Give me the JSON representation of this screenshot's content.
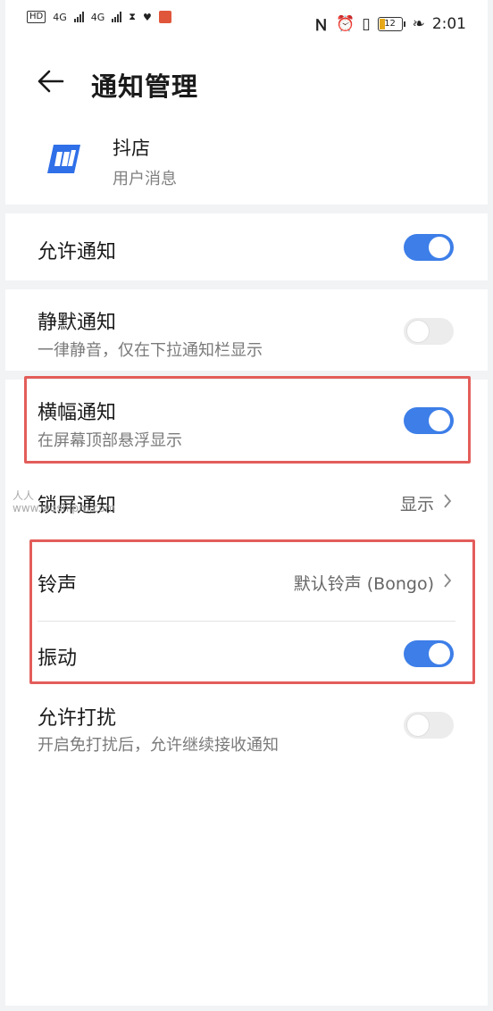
{
  "status_bar": {
    "left_labels": [
      "HD",
      "4G",
      "4G"
    ],
    "battery_level": "12",
    "time": "2:01"
  },
  "header": {
    "title": "通知管理"
  },
  "app": {
    "name": "抖店",
    "subtitle": "用户消息"
  },
  "settings": {
    "allow": {
      "label": "允许通知",
      "on": true
    },
    "silent": {
      "label": "静默通知",
      "desc": "一律静音，仅在下拉通知栏显示",
      "on": false
    },
    "banner": {
      "label": "横幅通知",
      "desc": "在屏幕顶部悬浮显示",
      "on": true
    },
    "lockscreen": {
      "label": "锁屏通知",
      "value": "显示"
    },
    "ringtone": {
      "label": "铃声",
      "value": "默认铃声 (Bongo)"
    },
    "vibrate": {
      "label": "振动",
      "on": true
    },
    "dnd": {
      "label": "允许打扰",
      "desc": "开启免打扰后，允许继续接收通知",
      "on": false
    }
  },
  "watermark": {
    "line1": "人人",
    "line2": "www.woshipm.com"
  },
  "colors": {
    "toggle_on": "#3d7ee8",
    "highlight": "#e35d5a",
    "app_icon": "#2f6fe8"
  }
}
